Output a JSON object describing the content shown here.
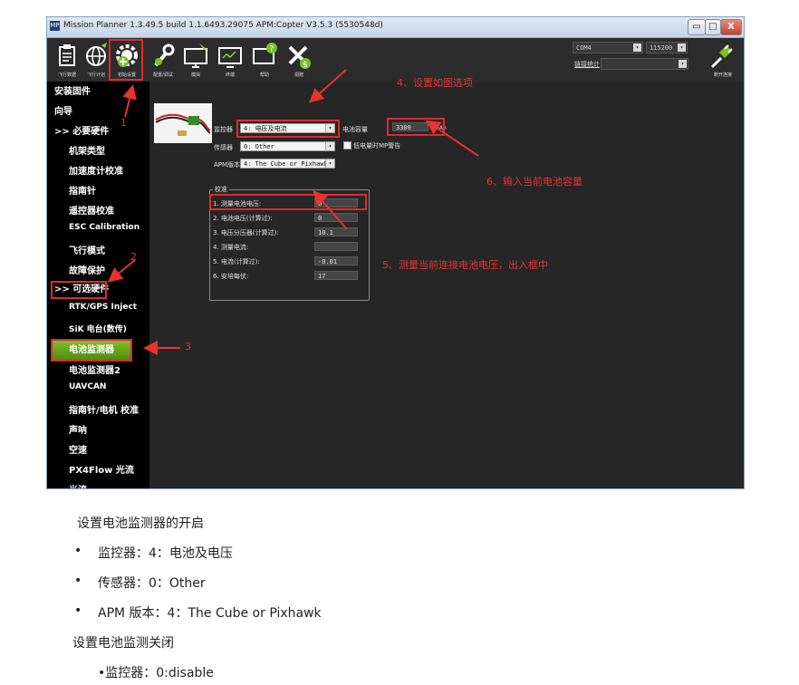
{
  "window": {
    "title": "Mission Planner 1.3.49.5 build 1.1.6493.29075 APM:Copter V3.5.3 (5530548d)",
    "icon_label": "MP",
    "controls": {
      "minimize": "▭",
      "maximize": "□",
      "close": "X"
    }
  },
  "toolbar": {
    "buttons": [
      {
        "label": "飞行数据",
        "icon": "clipboard-icon"
      },
      {
        "label": "飞行计划",
        "icon": "globe-icon"
      },
      {
        "label": "初始设置",
        "icon": "gear-plus-icon"
      },
      {
        "label": "配置/调试",
        "icon": "wrench-icon"
      },
      {
        "label": "模拟",
        "icon": "monitor-plane-icon"
      },
      {
        "label": "终端",
        "icon": "terminal-icon"
      },
      {
        "label": "帮助",
        "icon": "help-icon"
      },
      {
        "label": "捐赠",
        "icon": "donate-plane-icon"
      }
    ],
    "port": "COM4",
    "baud": "115200",
    "link_stats": "链接统计",
    "link_value": "",
    "connect_label": "断开连接"
  },
  "sidebar": {
    "items": [
      {
        "label": "安装固件"
      },
      {
        "label": "向导"
      },
      {
        "label": ">> 必要硬件"
      },
      {
        "label": "机架类型"
      },
      {
        "label": "加速度计校准"
      },
      {
        "label": "指南针"
      },
      {
        "label": "遥控器校准"
      },
      {
        "label": "ESC Calibration"
      },
      {
        "label": "飞行模式"
      },
      {
        "label": "故障保护"
      },
      {
        "label": ">> 可选硬件"
      },
      {
        "label": "RTK/GPS Inject"
      },
      {
        "label": "SiK 电台(数传)"
      },
      {
        "label": "电池监测器"
      },
      {
        "label": "电池监测器2"
      },
      {
        "label": "UAVCAN"
      },
      {
        "label": "指南针/电机 校准"
      },
      {
        "label": "声呐"
      },
      {
        "label": "空速"
      },
      {
        "label": "PX4Flow 光流"
      },
      {
        "label": "光流"
      }
    ]
  },
  "battery": {
    "monitor_label": "监控器",
    "monitor_value": "4: 电压及电流",
    "sensor_label": "传感器",
    "sensor_value": "0: Other",
    "apm_label": "APM版本",
    "apm_value": "4: The Cube or Pixhawk",
    "capacity_label": "电池容量",
    "capacity_value": "3300",
    "capacity_unit": "mAh",
    "low_warn_label": "低电量时MP警告",
    "calib_title": "校准",
    "calib": [
      {
        "label": "1. 测量电池电压:",
        "value": "0"
      },
      {
        "label": "2. 电池电压(计算过):",
        "value": "0"
      },
      {
        "label": "3. 电压分压器(计算过):",
        "value": "10.1"
      },
      {
        "label": "4. 测量电流:",
        "value": ""
      },
      {
        "label": "5. 电流(计算过):",
        "value": "-0.01"
      },
      {
        "label": "6. 安培每伏:",
        "value": "17"
      }
    ]
  },
  "annotations": {
    "n1": "1",
    "n2": "2",
    "n3": "3",
    "n4": "4、设置如图选项",
    "n5": "5、测量当前连接电池电压，出入框中",
    "n6": "6、输入当前电池容量",
    "color": "#e8332e"
  },
  "doc": {
    "open_title": "设置电池监测器的开启",
    "bullets": [
      "监控器：4：电池及电压",
      "传感器：0：Other",
      "APM 版本：4：The Cube or Pixhawk"
    ],
    "close_title": "设置电池监测关闭",
    "close_bullet": "•监控器：0:disable"
  }
}
